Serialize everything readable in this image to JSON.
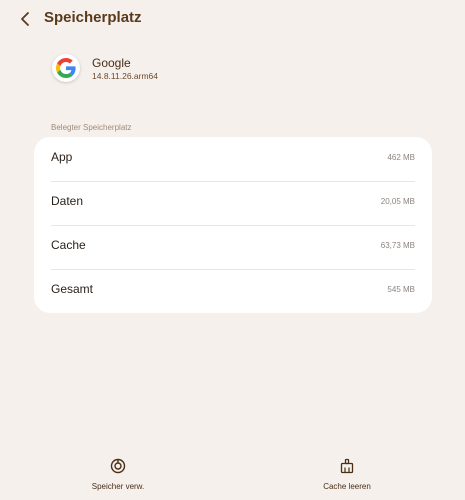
{
  "header": {
    "title": "Speicherplatz"
  },
  "app": {
    "name": "Google",
    "version": "14.8.11.26.arm64"
  },
  "storage": {
    "section_label": "Belegter Speicherplatz",
    "rows": [
      {
        "label": "App",
        "value": "462 MB"
      },
      {
        "label": "Daten",
        "value": "20,05 MB"
      },
      {
        "label": "Cache",
        "value": "63,73 MB"
      },
      {
        "label": "Gesamt",
        "value": "545 MB"
      }
    ]
  },
  "actions": {
    "manage_storage_label": "Speicher verw.",
    "clear_cache_label": "Cache leeren"
  },
  "colors": {
    "background": "#f5f0ec",
    "accent": "#5a3a1c",
    "card": "#ffffff"
  }
}
